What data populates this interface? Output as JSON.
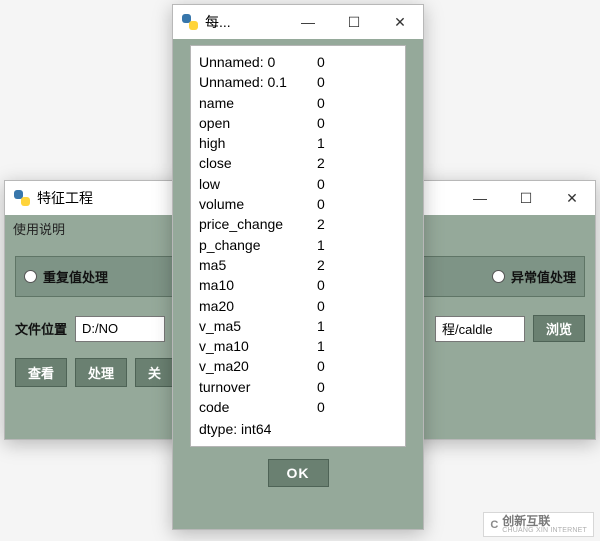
{
  "bg_window": {
    "title": "特征工程",
    "menu_label": "使用说明",
    "options": {
      "dup_label": "重复值处理",
      "outlier_label": "异常值处理"
    },
    "path_label": "文件位置",
    "path_value_left": "D:/NO",
    "path_value_right": "程/caldle",
    "browse_label": "浏览",
    "actions": {
      "view": "查看",
      "process": "处理",
      "close": "关"
    }
  },
  "fg_window": {
    "title": "每...",
    "ok_label": "OK",
    "dtype_label": "dtype: int64",
    "rows": [
      {
        "k": "Unnamed: 0",
        "v": "0"
      },
      {
        "k": "Unnamed: 0.1",
        "v": "0"
      },
      {
        "k": "name",
        "v": "0"
      },
      {
        "k": "open",
        "v": "0"
      },
      {
        "k": "high",
        "v": "1"
      },
      {
        "k": "close",
        "v": "2"
      },
      {
        "k": "low",
        "v": "0"
      },
      {
        "k": "volume",
        "v": "0"
      },
      {
        "k": "price_change",
        "v": "2"
      },
      {
        "k": "p_change",
        "v": "1"
      },
      {
        "k": "ma5",
        "v": "2"
      },
      {
        "k": "ma10",
        "v": "0"
      },
      {
        "k": "ma20",
        "v": "0"
      },
      {
        "k": "v_ma5",
        "v": "1"
      },
      {
        "k": "v_ma10",
        "v": "1"
      },
      {
        "k": "v_ma20",
        "v": "0"
      },
      {
        "k": "turnover",
        "v": "0"
      },
      {
        "k": "code",
        "v": "0"
      }
    ]
  },
  "watermark": {
    "logo": "C",
    "cn": "创新互联",
    "en": "CHUANG XIN INTERNET"
  },
  "winctl": {
    "min": "—",
    "max": "☐",
    "close": "✕"
  }
}
